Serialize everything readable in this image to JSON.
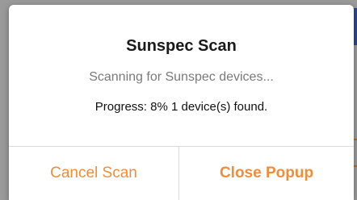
{
  "dialog": {
    "title": "Sunspec Scan",
    "subtitle": "Scanning for Sunspec devices...",
    "progress_text": "Progress: 8% 1 device(s) found.",
    "progress_percent": 8,
    "devices_found": 1
  },
  "buttons": {
    "cancel_label": "Cancel Scan",
    "close_label": "Close Popup"
  },
  "colors": {
    "accent": "#ef8d3d",
    "title": "#1a1a1a",
    "subtitle": "#7a7a7a",
    "overlay": "#9a9a9a"
  }
}
